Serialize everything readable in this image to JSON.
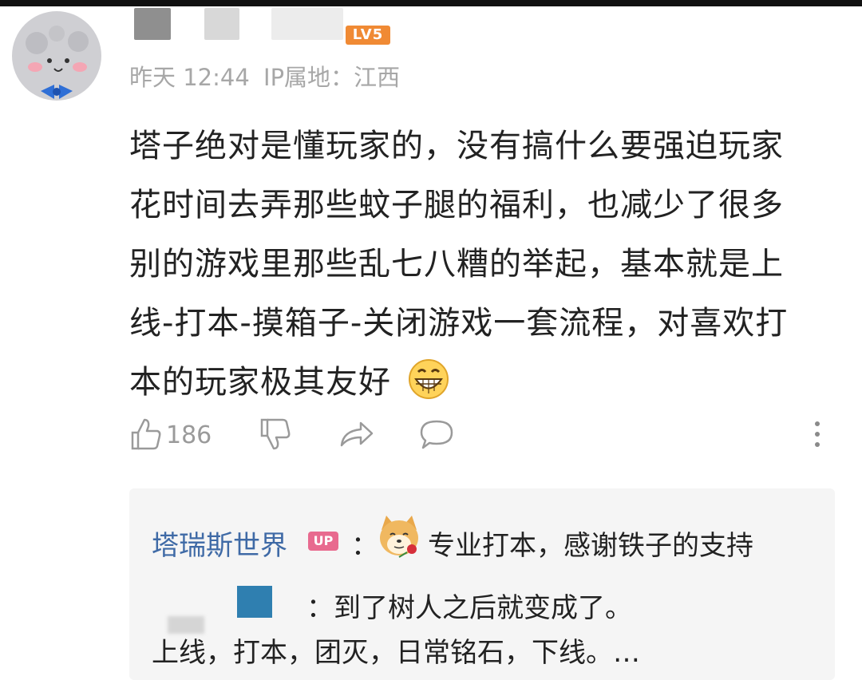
{
  "comment": {
    "level_badge": "LV5",
    "time": "昨天 12:44",
    "ip_label": "IP属地：",
    "location": "江西",
    "content_lines": [
      "塔子绝对是懂玩家的，没有搞什么要强迫玩家",
      "花时间去弄那些蚊子腿的福利，也减少了很多",
      "别的游戏里那些乱七八糟的举起，基本就是上",
      "线-打本-摸箱子-关闭游戏一套流程，对喜欢打",
      "本的玩家极其友好"
    ],
    "emoji": "grinning-emoji",
    "like_count": "186"
  },
  "replies": [
    {
      "author": "塔瑞斯世界",
      "badge": "UP",
      "colon": "：",
      "sticker": "shiba-rose-sticker",
      "text": "专业打本，感谢铁子的支持"
    },
    {
      "colon_text": "：到了树人之后就变成了。",
      "text_line2": "上线，打本，团灭，日常铭石，下线。…"
    }
  ],
  "colors": {
    "reply_name": "#3f6aa6",
    "level_badge": "#f08a34",
    "up_badge": "#e86a8f",
    "meta_gray": "#a7a7a7"
  }
}
